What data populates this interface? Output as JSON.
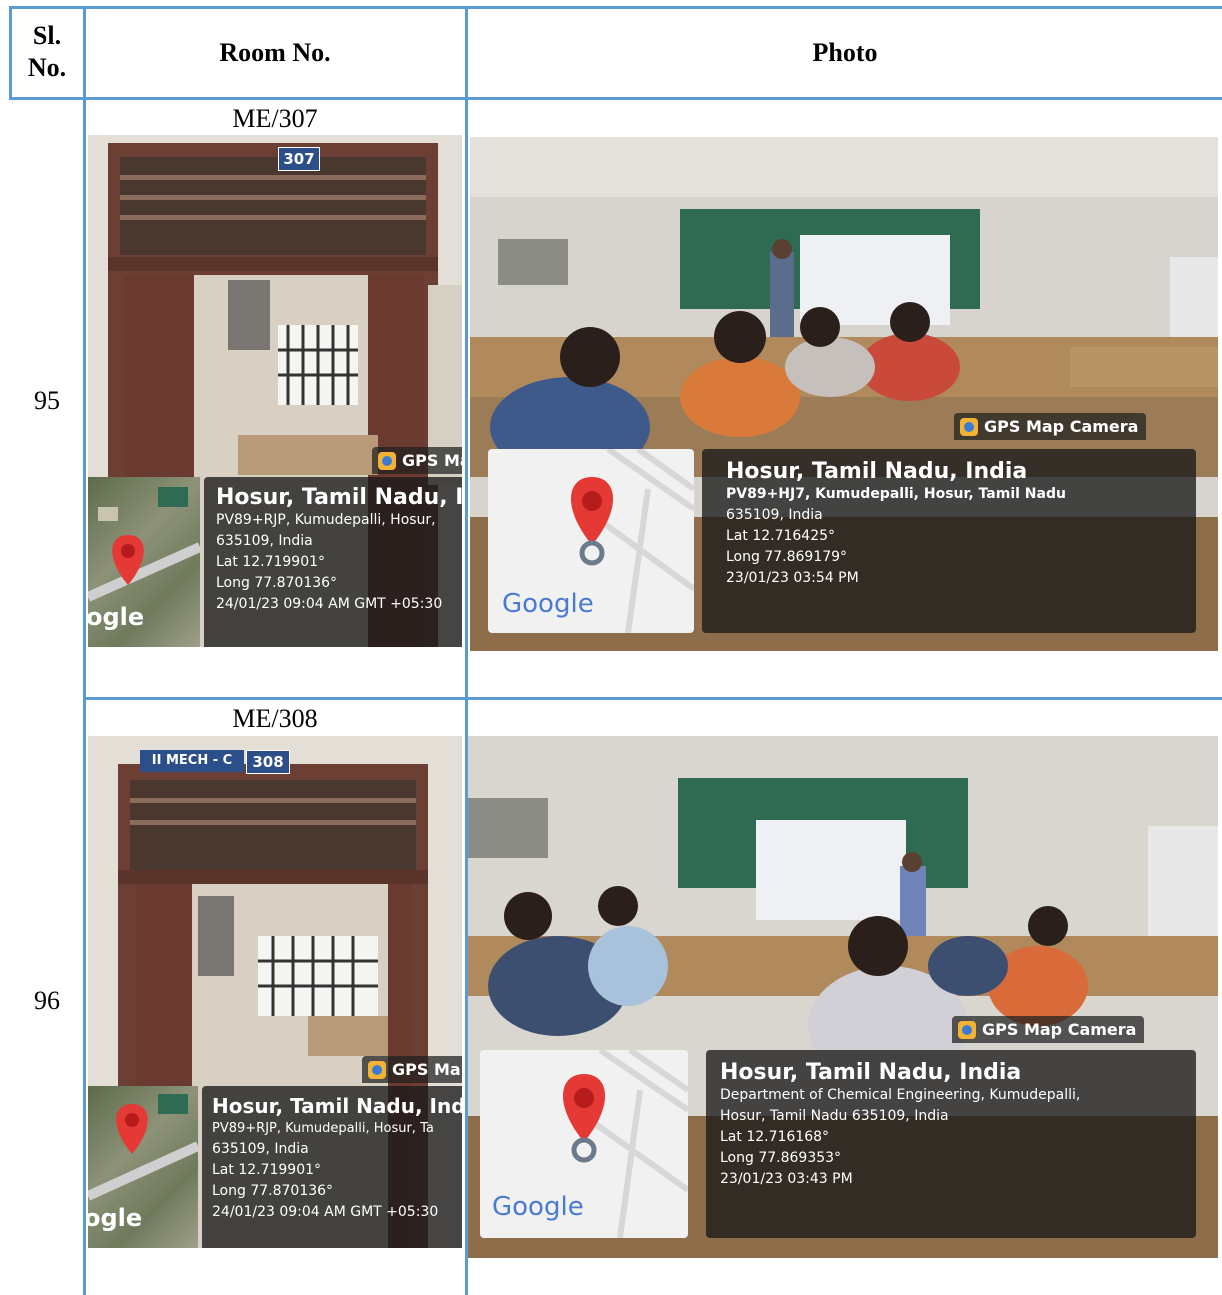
{
  "table": {
    "headers": {
      "sl_no": "Sl. No.",
      "room_no": "Room No.",
      "photo": "Photo"
    },
    "rows": [
      {
        "sl_no": "95",
        "room_no": "ME/307",
        "door_sign": "307",
        "door_photo": {
          "gps_tag": "GPS Ma",
          "location": "Hosur, Tamil Nadu, Indi",
          "address_1": "PV89+RJP, Kumudepalli, Hosur,",
          "address_2": "635109, India",
          "lat": "Lat 12.719901°",
          "long": "Long 77.870136°",
          "datetime": "24/01/23 09:04 AM GMT +05:30",
          "map_brand": "ogle"
        },
        "class_photo": {
          "gps_tag": "GPS Map Camera",
          "location": "Hosur, Tamil Nadu, India",
          "address_1": "PV89+HJ7, Kumudepalli, Hosur, Tamil Nadu",
          "address_2": "635109, India",
          "lat": "Lat 12.716425°",
          "long": "Long 77.869179°",
          "datetime": "23/01/23 03:54 PM",
          "map_brand": "Google"
        }
      },
      {
        "sl_no": "96",
        "room_no": "ME/308",
        "door_sign": "308",
        "door_sign_prefix": "II MECH - C",
        "door_photo": {
          "gps_tag": "GPS Ma",
          "location": "Hosur, Tamil Nadu, India",
          "address_1": "PV89+RJP, Kumudepalli, Hosur, Ta",
          "address_2": "635109, India",
          "lat": "Lat 12.719901°",
          "long": "Long 77.870136°",
          "datetime": "24/01/23 09:04 AM GMT +05:30",
          "map_brand": "ogle"
        },
        "class_photo": {
          "gps_tag": "GPS Map Camera",
          "location": "Hosur, Tamil Nadu, India",
          "address_1": "Department of Chemical Engineering, Kumudepalli,",
          "address_2": "Hosur, Tamil Nadu 635109, India",
          "lat": "Lat 12.716168°",
          "long": "Long 77.869353°",
          "datetime": "23/01/23 03:43 PM",
          "map_brand": "Google"
        }
      }
    ]
  },
  "colors": {
    "border": "#5b9bd5",
    "overlay": "#1e1e1e",
    "pin": "#e53935"
  }
}
